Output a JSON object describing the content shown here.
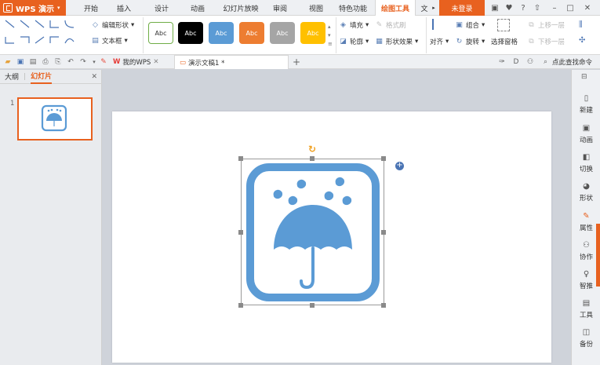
{
  "app": {
    "name": "WPS 演示"
  },
  "ribbon_tabs": [
    {
      "label": "开始"
    },
    {
      "label": "插入"
    },
    {
      "label": "设计"
    },
    {
      "label": "动画"
    },
    {
      "label": "幻灯片放映"
    },
    {
      "label": "审阅"
    },
    {
      "label": "视图"
    },
    {
      "label": "特色功能"
    },
    {
      "label": "绘图工具"
    },
    {
      "label": "文"
    }
  ],
  "login_label": "未登录",
  "ribbon": {
    "edit_shape": "编辑形状",
    "text_box": "文本框",
    "style_label": "Abc",
    "style_colors": [
      "#ffffff",
      "#000000",
      "#5b9bd5",
      "#ed7d31",
      "#a5a5a5",
      "#ffc000"
    ],
    "fill": "填充",
    "format_painter": "格式刷",
    "outline": "轮廓",
    "shape_effect": "形状效果",
    "align": "对齐",
    "group": "组合",
    "rotate": "旋转",
    "selection_pane": "选择窗格",
    "bring_forward": "上移一层",
    "send_backward": "下移一层"
  },
  "quick_access": {
    "my_wps": "我的WPS",
    "doc_tab": "演示文稿1 *",
    "find_command": "点此查找命令"
  },
  "left_panel": {
    "outline_tab": "大纲",
    "slides_tab": "幻灯片",
    "slide_number": "1"
  },
  "right_panel": [
    {
      "label": "新建",
      "icon": "new-icon"
    },
    {
      "label": "动画",
      "icon": "animation-icon"
    },
    {
      "label": "切换",
      "icon": "transition-icon"
    },
    {
      "label": "形状",
      "icon": "shape-icon"
    },
    {
      "label": "属性",
      "icon": "property-icon"
    },
    {
      "label": "协作",
      "icon": "collab-icon"
    },
    {
      "label": "智推",
      "icon": "recommend-icon"
    },
    {
      "label": "工具",
      "icon": "tools-icon"
    },
    {
      "label": "备份",
      "icon": "backup-icon"
    }
  ],
  "colors": {
    "accent": "#e8611f",
    "icon_blue": "#5b9bd5",
    "selection": "#8a8a8a"
  }
}
